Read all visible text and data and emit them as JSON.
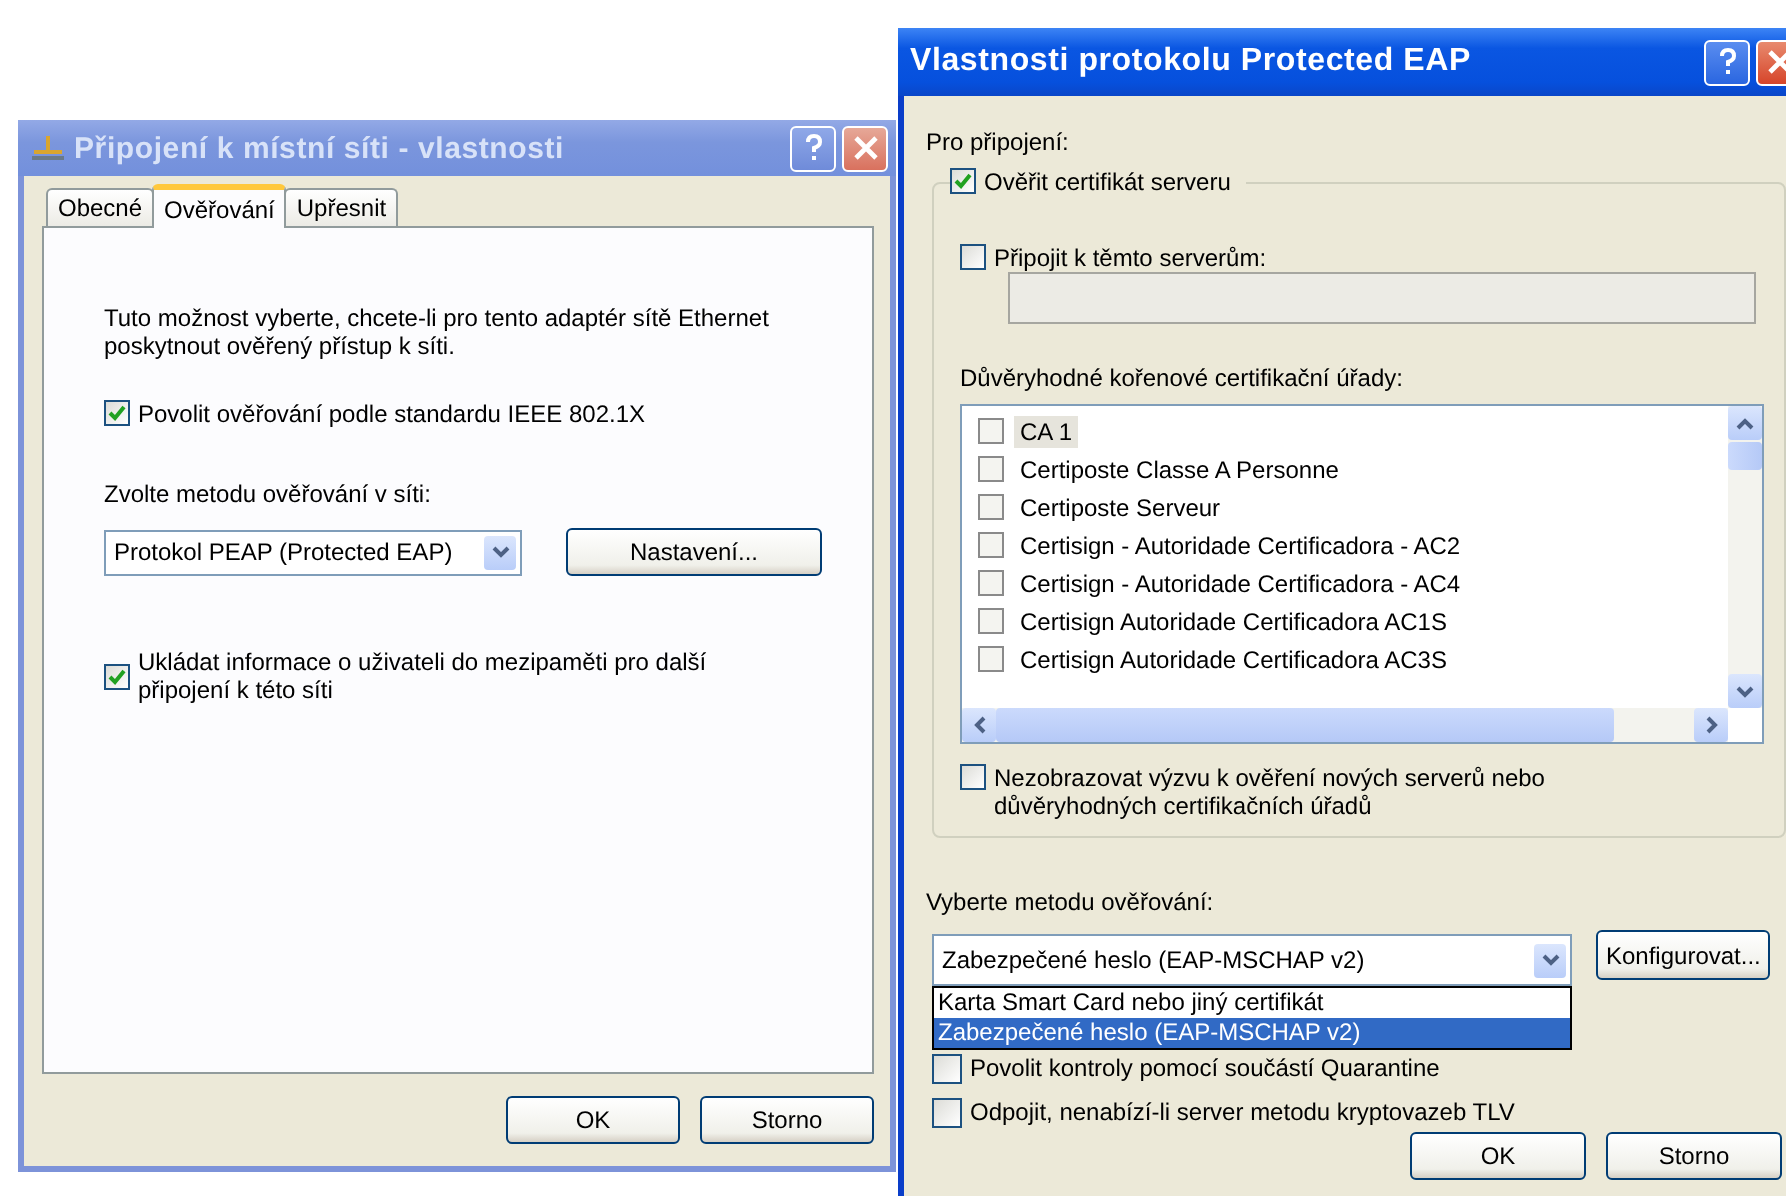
{
  "connection_dialog": {
    "title": "Připojení k místní síti - vlastnosti",
    "active": false,
    "tabs": [
      {
        "label": "Obecné",
        "selected": false
      },
      {
        "label": "Ověřování",
        "selected": true
      },
      {
        "label": "Upřesnit",
        "selected": false
      }
    ],
    "description": "Tuto možnost vyberte, chcete-li pro tento adaptér sítě Ethernet poskytnout ověřený přístup k síti.",
    "enable_8021x": {
      "label": "Povolit ověřování podle standardu IEEE 802.1X",
      "checked": true
    },
    "method_label": "Zvolte metodu ověřování v síti:",
    "method_select": {
      "value": "Protokol PEAP (Protected EAP)"
    },
    "settings_button": "Nastavení...",
    "cache_checkbox": {
      "label": "Ukládat informace o uživateli do mezipaměti pro další připojení k této síti",
      "checked": true
    },
    "buttons": [
      "OK",
      "Storno"
    ]
  },
  "peap_dialog": {
    "title": "Vlastnosti protokolu Protected EAP",
    "active": true,
    "section_label": "Pro připojení:",
    "validate_cert": {
      "label": "Ověřit certifikát serveru",
      "checked": true
    },
    "connect_servers": {
      "label": "Připojit k těmto serverům:",
      "checked": false
    },
    "servers_field": {
      "disabled": true
    },
    "ca_label": "Důvěryhodné kořenové certifikační úřady:",
    "ca_list": [
      {
        "name": "CA 1",
        "checked": false,
        "selected": true
      },
      {
        "name": "Certiposte Classe A Personne",
        "checked": false,
        "selected": false
      },
      {
        "name": "Certiposte Serveur",
        "checked": false,
        "selected": false
      },
      {
        "name": "Certisign - Autoridade Certificadora - AC2",
        "checked": false,
        "selected": false
      },
      {
        "name": "Certisign - Autoridade Certificadora - AC4",
        "checked": false,
        "selected": false
      },
      {
        "name": "Certisign Autoridade Certificadora AC1S",
        "checked": false,
        "selected": false
      },
      {
        "name": "Certisign Autoridade Certificadora AC3S",
        "checked": false,
        "selected": false
      }
    ],
    "no_prompt": {
      "label": "Nezobrazovat výzvu k ověření nových serverů nebo důvěryhodných certifikačních úřadů",
      "checked": false
    },
    "method_label": "Vyberte metodu ověřování:",
    "method_select": {
      "value": "Zabezpečené heslo (EAP-MSCHAP v2)",
      "expanded": true,
      "options": [
        {
          "label": "Karta Smart Card nebo jiný certifikát",
          "selected": false
        },
        {
          "label": "Zabezpečené heslo (EAP-MSCHAP v2)",
          "selected": true
        }
      ]
    },
    "configure_button": "Konfigurovat...",
    "options": [
      {
        "label": "Povolit kontroly pomocí součástí Quarantine",
        "checked": false
      },
      {
        "label": "Odpojit, nenabízí-li server metodu kryptovazeb TLV",
        "checked": false
      }
    ],
    "buttons": [
      "OK",
      "Storno"
    ]
  }
}
